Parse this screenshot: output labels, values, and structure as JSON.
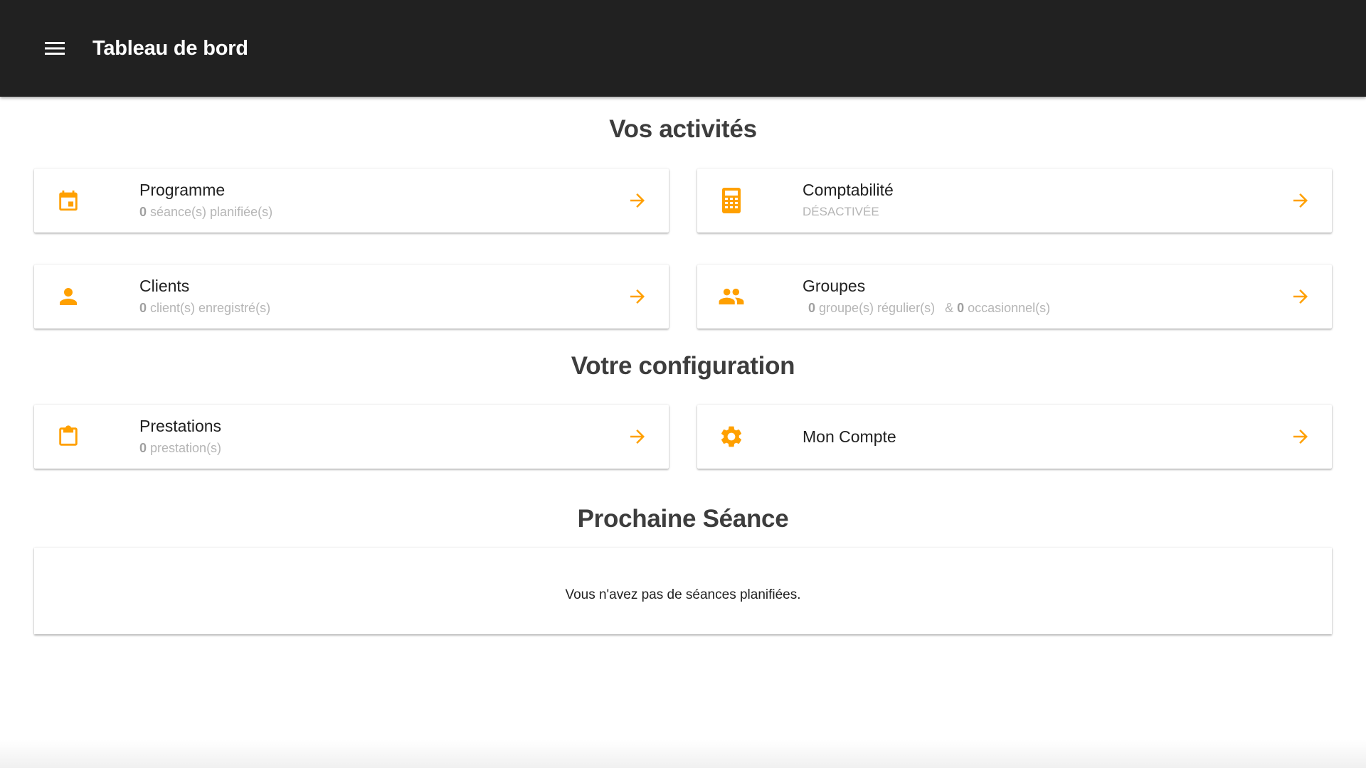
{
  "appbar": {
    "menu_icon": "menu-icon",
    "title": "Tableau de bord"
  },
  "sections": {
    "activities_title": "Vos activités",
    "config_title": "Votre configuration",
    "next_session_title": "Prochaine Séance"
  },
  "cards": {
    "programme": {
      "icon": "calendar-icon",
      "title": "Programme",
      "count": "0",
      "subtitle": " séance(s) planifiée(s)"
    },
    "comptabilite": {
      "icon": "calculator-icon",
      "title": "Comptabilité",
      "subtitle": "désactivée"
    },
    "clients": {
      "icon": "person-icon",
      "title": "Clients",
      "count": "0",
      "subtitle": " client(s) enregistré(s)"
    },
    "groupes": {
      "icon": "group-icon",
      "title": "Groupes",
      "regular_count": "0",
      "regular_label": " groupe(s) régulier(s)",
      "occasional_prefix": "& ",
      "occasional_count": "0",
      "occasional_label": " occasionnel(s)"
    },
    "prestations": {
      "icon": "clipboard-icon",
      "title": "Prestations",
      "count": "0",
      "subtitle": " prestation(s)"
    },
    "compte": {
      "icon": "gear-icon",
      "title": "Mon Compte"
    }
  },
  "next_session": {
    "empty_message": "Vous n'avez pas de séances planifiées."
  },
  "colors": {
    "accent": "#FFA000",
    "appbar": "#212121"
  }
}
